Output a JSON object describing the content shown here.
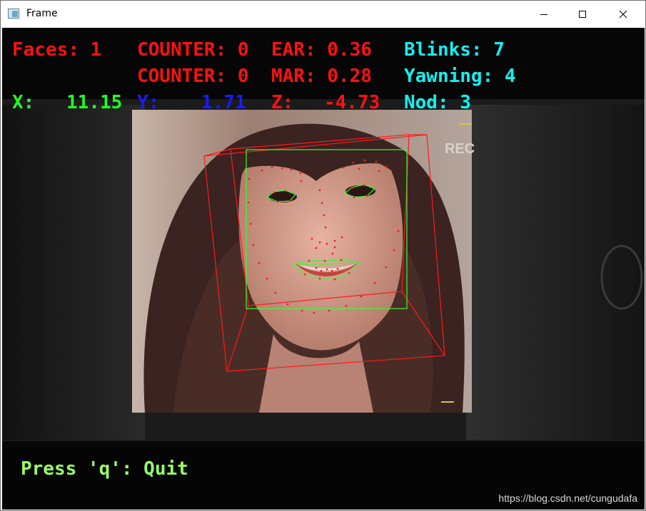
{
  "window": {
    "title": "Frame"
  },
  "hud": {
    "faces": "Faces: 1",
    "counter_eye": "COUNTER: 0",
    "ear": "EAR: 0.36",
    "blinks": "Blinks: 7",
    "counter_mouth": "COUNTER: 0",
    "mar": "MAR: 0.28",
    "yawning": "Yawning: 4",
    "x_label": "X:",
    "x_value": "11.15",
    "y_label": "Y:",
    "y_value": "1.71",
    "z_label": "Z:",
    "z_value": "-4.73",
    "nod": "Nod: 3",
    "quit_hint": "Press 'q': Quit"
  },
  "watermark": "https://blog.csdn.net/cungudafa",
  "colors": {
    "red": "#ff1111",
    "green": "#22ff22",
    "blue": "#1a1aff",
    "cyan": "#11f0f0",
    "lime": "#99ff66"
  },
  "icons": {
    "app": "window-app-icon",
    "minimize": "minimize-icon",
    "maximize": "maximize-icon",
    "close": "close-icon"
  }
}
